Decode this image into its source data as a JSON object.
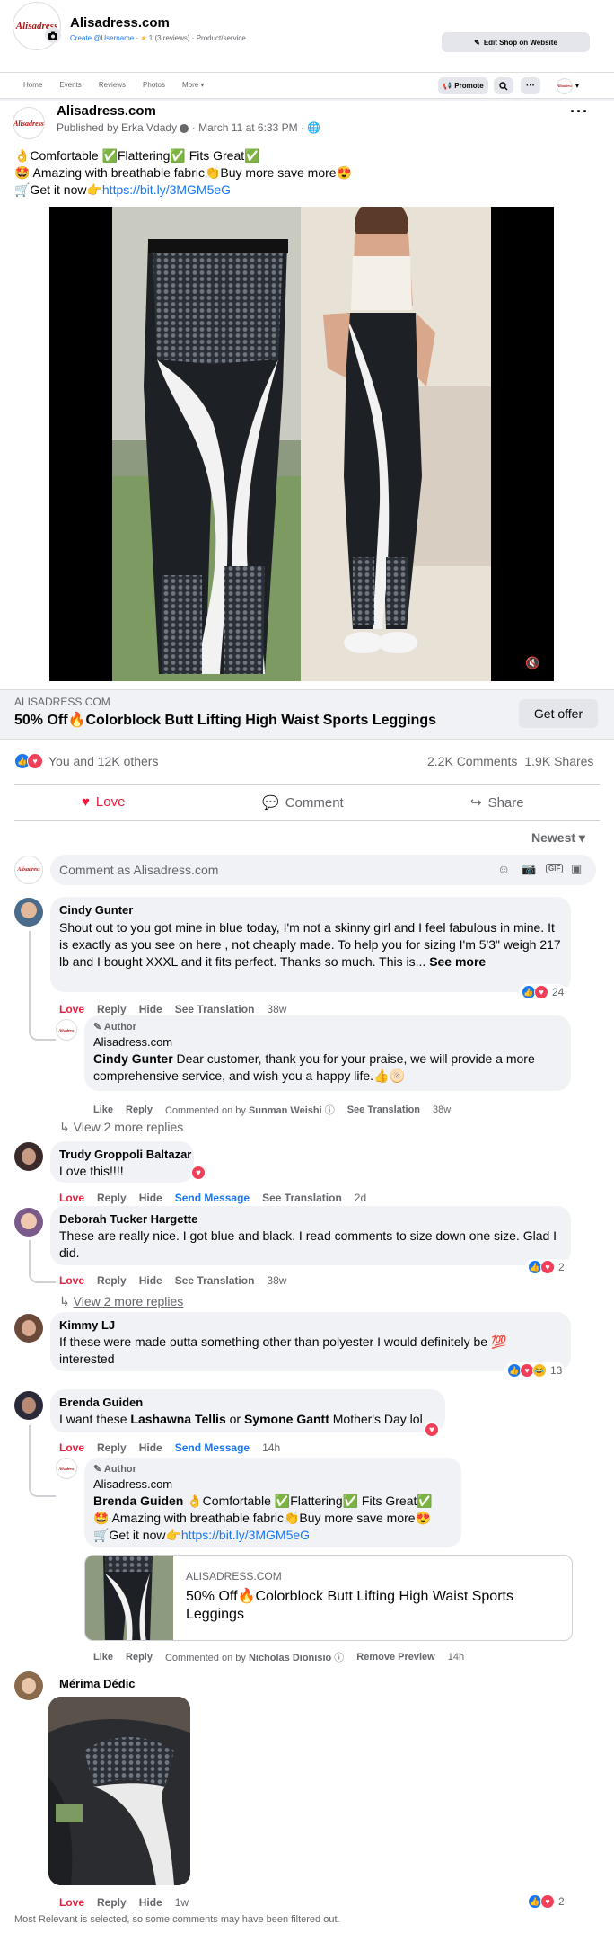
{
  "page": {
    "logo_text": "Alisadress",
    "name": "Alisadress.com",
    "create_username": "Create @Username",
    "rating_text": "1 (3 reviews)",
    "category": "Product/service",
    "edit_shop": "Edit Shop on Website"
  },
  "nav": {
    "tabs": [
      "Home",
      "Events",
      "Reviews",
      "Photos",
      "More"
    ],
    "promote": "Promote"
  },
  "post": {
    "author": "Alisadress.com",
    "published_by": "Published by Erka Vdady",
    "date": "March 11 at 6:33 PM",
    "line1": "👌Comfortable ✅Flattering✅ Fits Great✅",
    "line2": "🤩 Amazing with breathable fabric👏Buy more save more😍",
    "line3_prefix": "🛒Get it now👉",
    "link": "https://bit.ly/3MGM5eG",
    "link_domain": "ALISADRESS.COM",
    "link_title": "50% Off🔥Colorblock Butt Lifting High Waist Sports Leggings",
    "get_offer": "Get offer",
    "reactions_text": "You and 12K others",
    "comments_count": "2.2K Comments",
    "shares_count": "1.9K Shares",
    "actions": {
      "love": "Love",
      "comment": "Comment",
      "share": "Share"
    },
    "sort": "Newest",
    "comment_placeholder": "Comment as Alisadress.com",
    "footer_note": "Most Relevant is selected, so some comments may have been filtered out."
  },
  "comments": {
    "c1": {
      "name": "Cindy Gunter",
      "text": "Shout out to you got mine in blue today, I'm not a skinny girl and I feel fabulous in mine. It is exactly as you see on here , not cheaply made. To help you for sizing I'm 5'3\" weigh 217 lb and I bought XXXL and it fits perfect. Thanks so much. This is...",
      "see_more": "See more",
      "count": "24",
      "time": "38w"
    },
    "r1": {
      "author_tag": "Author",
      "name": "Alisadress.com",
      "mention": "Cindy Gunter",
      "text": " Dear customer, thank you for your praise, we will provide a more comprehensive service, and wish you a happy life.👍🫓",
      "commented_on_by": "Commented on by",
      "commenter": "Sunman Weishi",
      "time": "38w"
    },
    "view_more_1": "View 2 more replies",
    "c2": {
      "name": "Trudy Groppoli Baltazar",
      "text": "Love this!!!!",
      "time": "2d",
      "send_message": "Send Message"
    },
    "c3": {
      "name": "Deborah Tucker Hargette",
      "text": "These are really nice. I got blue and black. I read comments to size down one size. Glad I did.",
      "count": "2",
      "time": "38w"
    },
    "view_more_2": "View 2 more replies",
    "c4": {
      "name": "Kimmy LJ",
      "text": "If these were made outta something other than polyester I would definitely be 💯 interested",
      "count": "13"
    },
    "c5": {
      "name": "Brenda Guiden",
      "text_prefix": "I want these ",
      "mention1": "Lashawna Tellis",
      "or": " or ",
      "mention2": "Symone Gantt",
      "text_suffix": " Mother's Day lol",
      "send_message": "Send Message",
      "time": "14h"
    },
    "r2": {
      "author_tag": "Author",
      "name": "Alisadress.com",
      "mention": "Brenda Guiden",
      "line1": " 👌Comfortable ✅Flattering✅ Fits Great✅",
      "line2": "🤩 Amazing with breathable fabric👏Buy more save more😍",
      "line3_prefix": "🛒Get it now👉",
      "link": "https://bit.ly/3MGM5eG",
      "card_domain": "ALISADRESS.COM",
      "card_title": "50% Off🔥Colorblock Butt Lifting High Waist Sports Leggings",
      "commented_on_by": "Commented on by",
      "commenter": "Nicholas Dionisio",
      "remove_preview": "Remove Preview",
      "time": "14h"
    },
    "c6": {
      "name": "Mérima Dédic",
      "count": "2",
      "time": "1w"
    }
  },
  "labels": {
    "love": "Love",
    "reply": "Reply",
    "hide": "Hide",
    "see_translation": "See Translation",
    "like": "Like"
  },
  "colors": {
    "brand_blue": "#1877f2",
    "love_red": "#e41e3f",
    "background": "#f0f2f5"
  }
}
